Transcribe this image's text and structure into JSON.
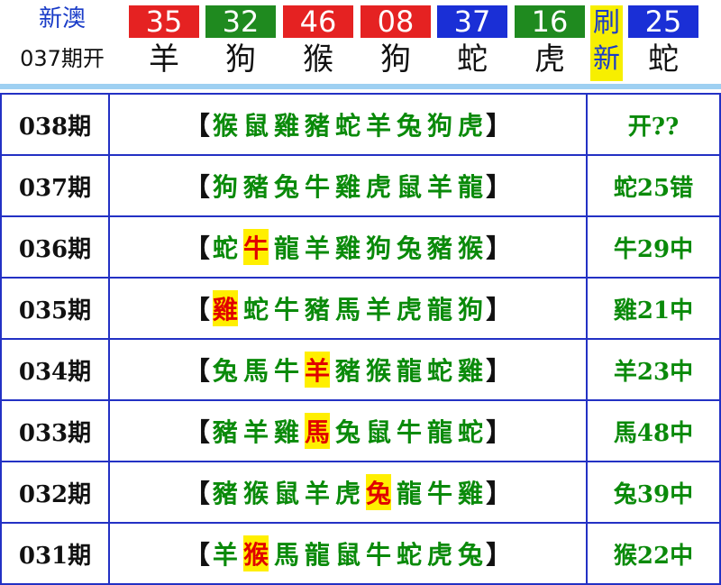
{
  "header": {
    "brand_name": "新澳",
    "period": "037期开",
    "refresh_top": "刷",
    "refresh_bottom": "新",
    "balls": [
      {
        "number": "35",
        "zodiac": "羊",
        "color": "#e52222"
      },
      {
        "number": "32",
        "zodiac": "狗",
        "color": "#1f8a1f"
      },
      {
        "number": "46",
        "zodiac": "猴",
        "color": "#e52222"
      },
      {
        "number": "08",
        "zodiac": "狗",
        "color": "#e52222"
      },
      {
        "number": "37",
        "zodiac": "蛇",
        "color": "#1a2fd6"
      },
      {
        "number": "16",
        "zodiac": "虎",
        "color": "#1f8a1f"
      }
    ],
    "special": {
      "number": "25",
      "zodiac": "蛇",
      "color": "#1a2fd6"
    }
  },
  "rows": [
    {
      "period": "038期",
      "open_bracket": "【",
      "close_bracket": "】",
      "zodiacs": [
        "猴",
        "鼠",
        "雞",
        "豬",
        "蛇",
        "羊",
        "兔",
        "狗",
        "虎"
      ],
      "hit_index": -1,
      "result": "开??"
    },
    {
      "period": "037期",
      "open_bracket": "【",
      "close_bracket": "】",
      "zodiacs": [
        "狗",
        "豬",
        "兔",
        "牛",
        "雞",
        "虎",
        "鼠",
        "羊",
        "龍"
      ],
      "hit_index": -1,
      "result": "蛇25错"
    },
    {
      "period": "036期",
      "open_bracket": "【",
      "close_bracket": "】",
      "zodiacs": [
        "蛇",
        "牛",
        "龍",
        "羊",
        "雞",
        "狗",
        "兔",
        "豬",
        "猴"
      ],
      "hit_index": 1,
      "result": "牛29中"
    },
    {
      "period": "035期",
      "open_bracket": "【",
      "close_bracket": "】",
      "zodiacs": [
        "雞",
        "蛇",
        "牛",
        "豬",
        "馬",
        "羊",
        "虎",
        "龍",
        "狗"
      ],
      "hit_index": 0,
      "result": "雞21中"
    },
    {
      "period": "034期",
      "open_bracket": "【",
      "close_bracket": "】",
      "zodiacs": [
        "兔",
        "馬",
        "牛",
        "羊",
        "豬",
        "猴",
        "龍",
        "蛇",
        "雞"
      ],
      "hit_index": 3,
      "result": "羊23中"
    },
    {
      "period": "033期",
      "open_bracket": "【",
      "close_bracket": "】",
      "zodiacs": [
        "豬",
        "羊",
        "雞",
        "馬",
        "兔",
        "鼠",
        "牛",
        "龍",
        "蛇"
      ],
      "hit_index": 3,
      "result": "馬48中"
    },
    {
      "period": "032期",
      "open_bracket": "【",
      "close_bracket": "】",
      "zodiacs": [
        "豬",
        "猴",
        "鼠",
        "羊",
        "虎",
        "兔",
        "龍",
        "牛",
        "雞"
      ],
      "hit_index": 5,
      "result": "兔39中"
    },
    {
      "period": "031期",
      "open_bracket": "【",
      "close_bracket": "】",
      "zodiacs": [
        "羊",
        "猴",
        "馬",
        "龍",
        "鼠",
        "牛",
        "蛇",
        "虎",
        "兔"
      ],
      "hit_index": 1,
      "result": "猴22中"
    }
  ]
}
